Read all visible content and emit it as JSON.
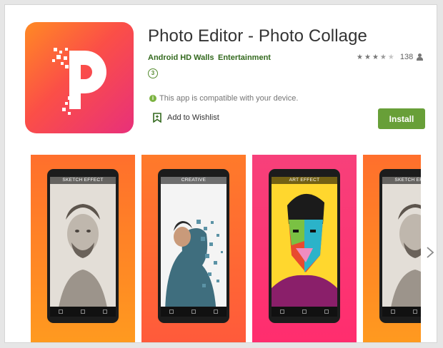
{
  "app": {
    "title": "Photo Editor - Photo Collage",
    "developer": "Android HD Walls",
    "category": "Entertainment",
    "rating_stars": 3.5,
    "rating_count": "138",
    "content_rating": "3",
    "compat_text": "This app is compatible with your device.",
    "wishlist_label": "Add to Wishlist",
    "install_label": "Install",
    "icon_letter": "P",
    "accent_color": "#689f38",
    "link_color": "#33691e"
  },
  "screenshots": [
    {
      "label": "SKETCH EFFECT",
      "bg_start": "#ff6f2c",
      "bg_end": "#ff9a1f"
    },
    {
      "label": "CREATIVE",
      "bg_start": "#ff7a2a",
      "bg_end": "#ff5a3b"
    },
    {
      "label": "ART EFFECT",
      "bg_start": "#f7407a",
      "bg_end": "#ff2d6e"
    },
    {
      "label": "SKETCH EFFECT",
      "bg_start": "#ff6f2c",
      "bg_end": "#ff9a1f"
    }
  ],
  "icons": {
    "user": "person-icon",
    "info": "info-icon",
    "bookmark": "bookmark-add-icon",
    "next": "chevron-right-icon"
  }
}
